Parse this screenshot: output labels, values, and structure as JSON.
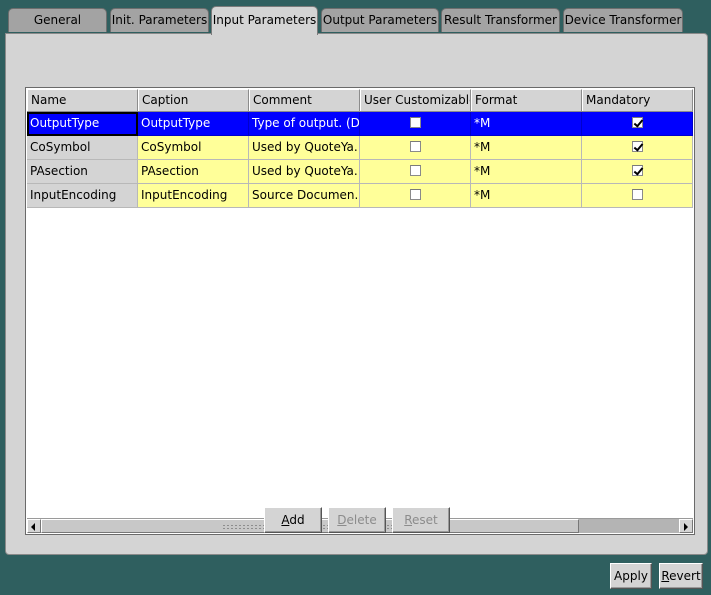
{
  "tabs": [
    {
      "label": "General",
      "active": false
    },
    {
      "label": "Init. Parameters",
      "active": false
    },
    {
      "label": "Input Parameters",
      "active": true
    },
    {
      "label": "Output Parameters",
      "active": false
    },
    {
      "label": "Result Transformer",
      "active": false
    },
    {
      "label": "Device Transformer",
      "active": false
    }
  ],
  "table": {
    "columns": [
      "Name",
      "Caption",
      "Comment",
      "User Customizable",
      "Format",
      "Mandatory"
    ],
    "rows": [
      {
        "name": "OutputType",
        "caption": "OutputType",
        "comment": "Type of output. (D...",
        "user_customizable": false,
        "format": "*M",
        "mandatory": true,
        "selected": true
      },
      {
        "name": "CoSymbol",
        "caption": "CoSymbol",
        "comment": "Used by QuoteYa...",
        "user_customizable": false,
        "format": "*M",
        "mandatory": true,
        "selected": false
      },
      {
        "name": "PAsection",
        "caption": "PAsection",
        "comment": "Used by QuoteYa...",
        "user_customizable": false,
        "format": "*M",
        "mandatory": true,
        "selected": false
      },
      {
        "name": "InputEncoding",
        "caption": "InputEncoding",
        "comment": "Source Documen...",
        "user_customizable": false,
        "format": "*M",
        "mandatory": false,
        "selected": false
      }
    ]
  },
  "buttons": {
    "add": {
      "mnemonic": "A",
      "rest": "dd",
      "enabled": true
    },
    "delete": {
      "mnemonic": "D",
      "rest": "elete",
      "enabled": false
    },
    "reset": {
      "mnemonic": "R",
      "rest": "eset",
      "enabled": false
    },
    "apply": {
      "label": "Apply"
    },
    "revert": {
      "mnemonic": "R",
      "rest": "evert"
    }
  },
  "colors": {
    "background": "#2f5f5f",
    "panel": "#d4d4d4",
    "selection": "#0000ff",
    "row_highlight": "#ffff99"
  }
}
